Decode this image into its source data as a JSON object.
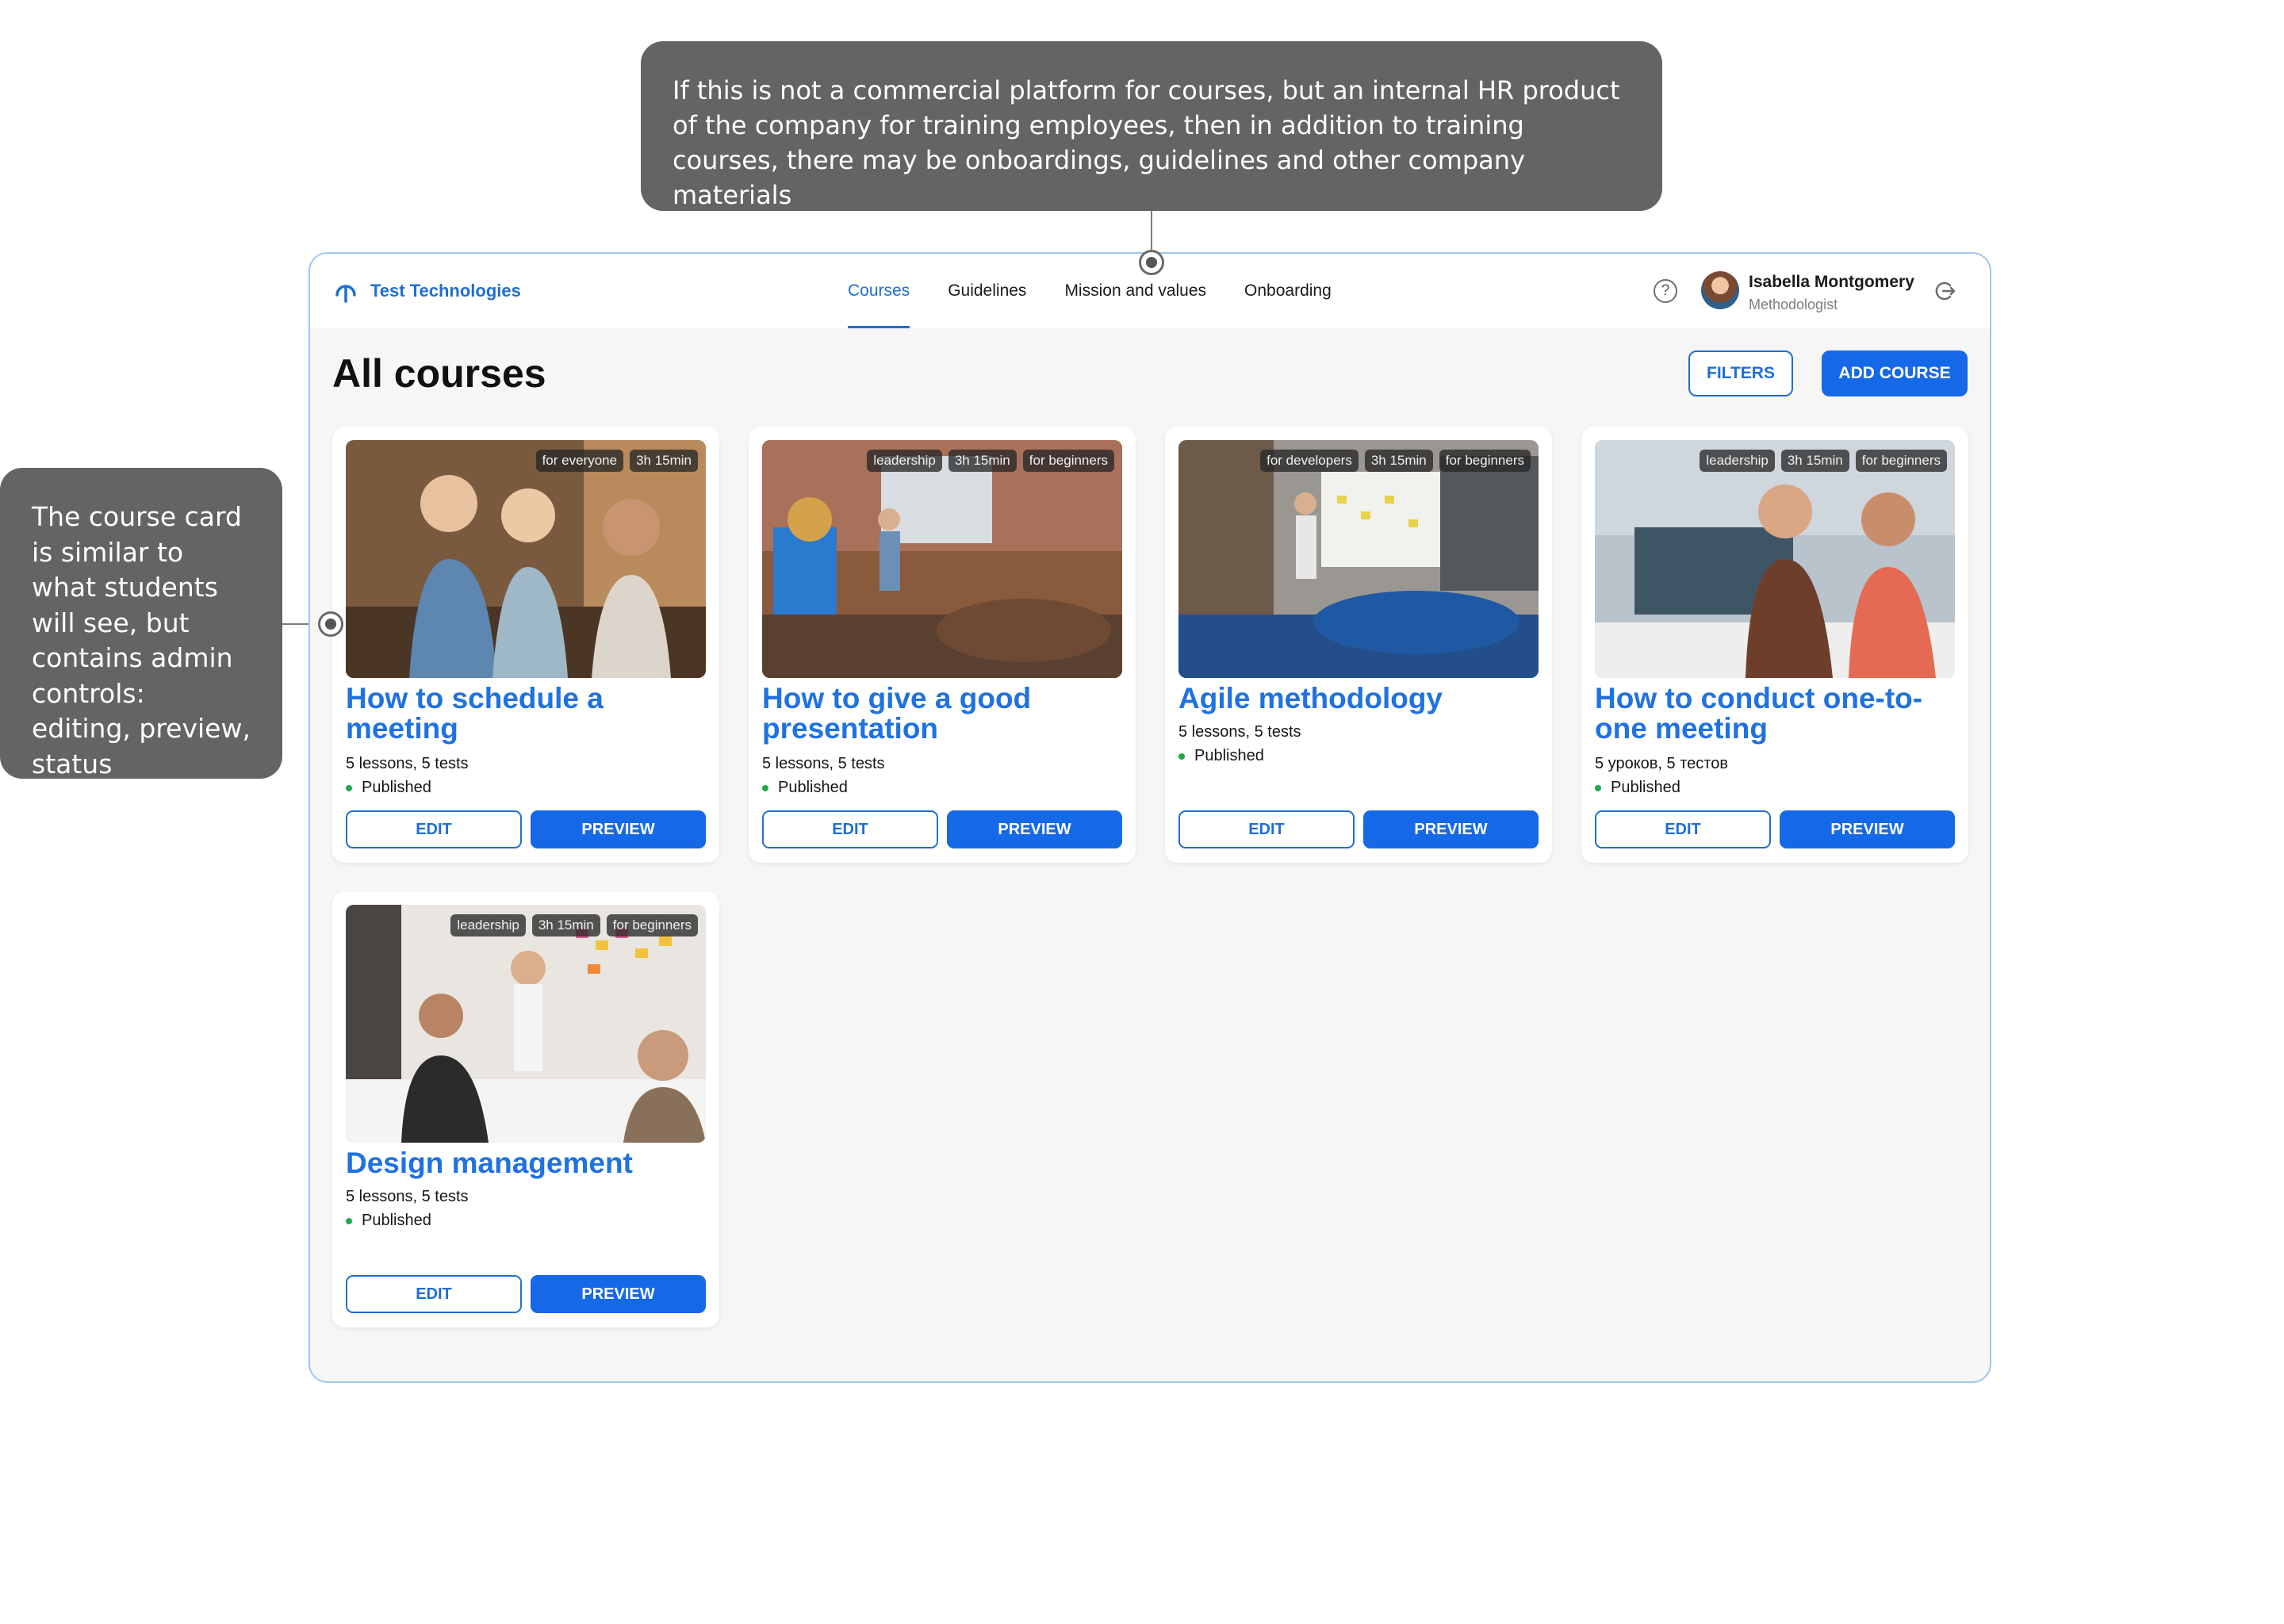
{
  "annotations": {
    "top": "If this is not a commercial platform for courses, but an internal HR product of the company for training employees, then in addition to training courses, there may be onboardings, guidelines and other company materials",
    "left": "The course card is similar to what students will see, but contains admin controls: editing, preview, status"
  },
  "header": {
    "brand": "Test Technologies",
    "nav": [
      "Courses",
      "Guidelines",
      "Mission and values",
      "Onboarding"
    ],
    "active_nav": "Courses",
    "help_icon": "?",
    "user": {
      "name": "Isabella Montgomery",
      "role": "Methodologist"
    }
  },
  "main": {
    "title": "All courses",
    "filters_label": "FILTERS",
    "add_label": "ADD COURSE"
  },
  "cards": [
    {
      "title": "How to schedule a meeting",
      "tags": [
        "for everyone",
        "3h 15min"
      ],
      "meta": "5 lessons, 5 tests",
      "status": "Published",
      "edit": "EDIT",
      "preview": "PREVIEW"
    },
    {
      "title": "How to give a good presentation",
      "tags": [
        "leadership",
        "3h 15min",
        "for beginners"
      ],
      "meta": "5 lessons, 5 tests",
      "status": "Published",
      "edit": "EDIT",
      "preview": "PREVIEW"
    },
    {
      "title": "Agile methodology",
      "tags": [
        "for developers",
        "3h 15min",
        "for beginners"
      ],
      "meta": "5 lessons, 5 tests",
      "status": "Published",
      "edit": "EDIT",
      "preview": "PREVIEW"
    },
    {
      "title": "How to conduct one-to-one meeting",
      "tags": [
        "leadership",
        "3h 15min",
        "for beginners"
      ],
      "meta": "5 уроков, 5 тестов",
      "status": "Published",
      "edit": "EDIT",
      "preview": "PREVIEW"
    },
    {
      "title": "Design management",
      "tags": [
        "leadership",
        "3h 15min",
        "for beginners"
      ],
      "meta": "5 lessons, 5 tests",
      "status": "Published",
      "edit": "EDIT",
      "preview": "PREVIEW"
    }
  ],
  "colors": {
    "accent": "#1669e6",
    "status_published": "#22a84a",
    "annotation_bg": "#646464"
  }
}
